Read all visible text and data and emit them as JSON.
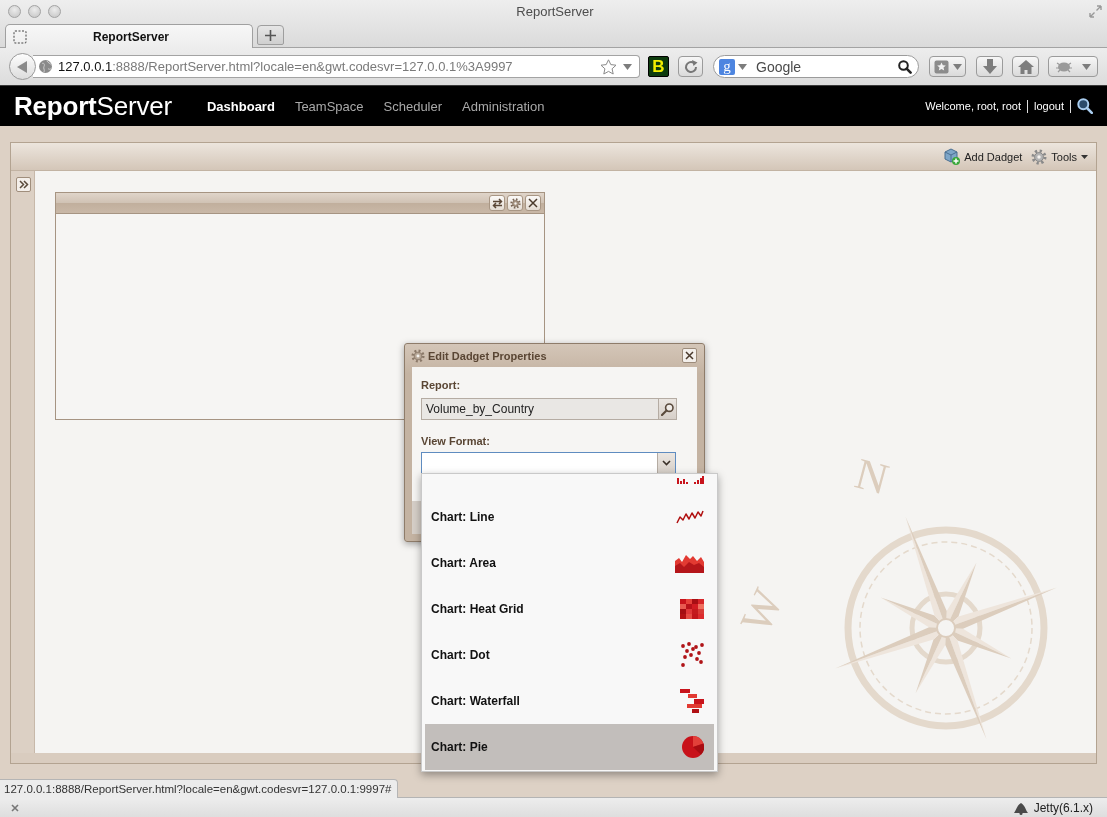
{
  "browser": {
    "window_title": "ReportServer",
    "tabs": [
      {
        "title": "ReportServer",
        "selected": true
      }
    ],
    "address": {
      "host": "127.0.0.1",
      "rest": ":8888/ReportServer.html?locale=en&gwt.codesvr=127.0.0.1%3A9997"
    },
    "extension_letter": "B",
    "search": {
      "engine_letter": "g",
      "placeholder": "Google"
    }
  },
  "app_header": {
    "logo": "**Report**Server",
    "nav": [
      {
        "label": "Dashboard",
        "selected": true
      },
      {
        "label": "TeamSpace",
        "selected": false
      },
      {
        "label": "Scheduler",
        "selected": false
      },
      {
        "label": "Administration",
        "selected": false
      }
    ],
    "welcome": "Welcome, root, root",
    "logout": "logout"
  },
  "dashboard": {
    "toolbar": [
      {
        "label": "Add Dadget",
        "kind": "add",
        "menu": false
      },
      {
        "label": "Tools",
        "kind": "tools",
        "menu": true
      }
    ],
    "compass_letters": [
      "N",
      "W"
    ]
  },
  "dialog": {
    "title": "Edit Dadget Properties",
    "report": {
      "label": "Report:",
      "value": "Volume_by_Country"
    },
    "view_format": {
      "label": "View Format:",
      "focused": true,
      "expanded": true,
      "partial_option": {
        "kind": "bar"
      },
      "options": [
        {
          "label": "Chart: Line",
          "kind": "line",
          "selected": false
        },
        {
          "label": "Chart: Area",
          "kind": "area",
          "selected": false
        },
        {
          "label": "Chart: Heat Grid",
          "kind": "heat",
          "selected": false
        },
        {
          "label": "Chart: Dot",
          "kind": "dot",
          "selected": false
        },
        {
          "label": "Chart: Waterfall",
          "kind": "waterfall",
          "selected": false
        },
        {
          "label": "Chart: Pie",
          "kind": "pie",
          "selected": true
        }
      ]
    }
  },
  "status_bar": {
    "link_url": "127.0.0.1:8888/ReportServer.html?locale=en&gwt.codesvr=127.0.0.1:9997#"
  },
  "addon_bar": {
    "label": "Jetty(6.1.x)"
  }
}
